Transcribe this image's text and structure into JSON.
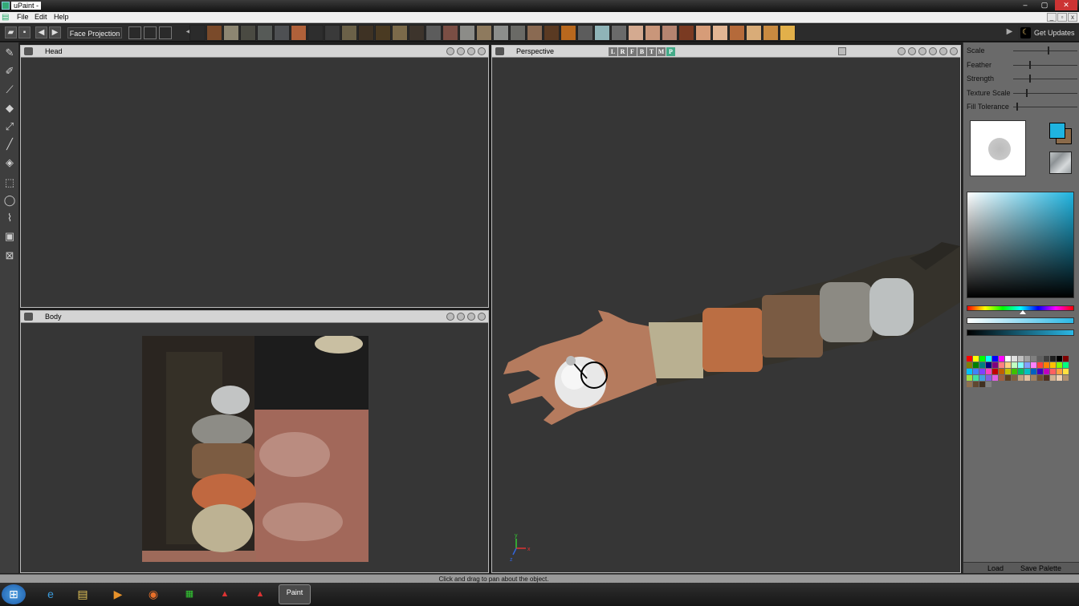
{
  "window": {
    "title": "uPaint -",
    "minimize": "–",
    "maximize": "▢",
    "close": "✕"
  },
  "menu": {
    "items": [
      "File",
      "Edit",
      "Help"
    ]
  },
  "toolbar": {
    "face_projection": "Face Projection",
    "get_updates": "Get Updates",
    "swatches": [
      "#2b2b2b",
      "#7a4a2a",
      "#8d8672",
      "#4a4a42",
      "#565a57",
      "#4e5053",
      "#b0613a",
      "#2e2e2e",
      "#3a3a3a",
      "#6b6148",
      "#3e3224",
      "#4a3a22",
      "#7b6a4a",
      "#3d342c",
      "#5c5c5c",
      "#7a4e44",
      "#8c8c88",
      "#8e7a5e",
      "#8c8e8c",
      "#6a6a66",
      "#8a6a52",
      "#5a3a22",
      "#b8681e",
      "#5c5c5c",
      "#8fb4b8",
      "#6a6a6a",
      "#d4aa90",
      "#c9967a",
      "#b58470",
      "#7a3a22",
      "#d69c78",
      "#e2b694",
      "#b56a3a",
      "#d9ac78",
      "#c88a40",
      "#e2b04a"
    ]
  },
  "panels": {
    "head": {
      "title": "Head"
    },
    "body": {
      "title": "Body"
    },
    "perspective": {
      "title": "Perspective",
      "view_letters": [
        "L",
        "R",
        "F",
        "B",
        "T",
        "M",
        "P"
      ]
    }
  },
  "right_panel": {
    "sliders": [
      {
        "label": "Scale",
        "value": 0.55
      },
      {
        "label": "Feather",
        "value": 0.25
      },
      {
        "label": "Strength",
        "value": 0.25
      },
      {
        "label": "Texture Scale",
        "value": 0.2
      },
      {
        "label": "Fill Tolerance",
        "value": 0.05
      }
    ],
    "primary_color": "#1fb4e0",
    "secondary_color": "#8a6a4a",
    "load_label": "Load",
    "save_palette_label": "Save Palette",
    "palette": [
      "#ff0000",
      "#ffff00",
      "#00ff00",
      "#00ffff",
      "#0000ff",
      "#ff00ff",
      "#ffffff",
      "#e0e0e0",
      "#c0c0c0",
      "#a0a0a0",
      "#808080",
      "#606060",
      "#404040",
      "#202020",
      "#000000",
      "#800000",
      "#808000",
      "#008000",
      "#008080",
      "#000080",
      "#800080",
      "#ff8080",
      "#ffd080",
      "#c0ffc0",
      "#80ffff",
      "#80a0ff",
      "#ff80ff",
      "#ff4040",
      "#ff8000",
      "#ffc000",
      "#80ff00",
      "#00ff80",
      "#00c0ff",
      "#4080ff",
      "#8040ff",
      "#ff40c0",
      "#c00000",
      "#c06000",
      "#c0c000",
      "#40c000",
      "#00c060",
      "#00c0c0",
      "#0060c0",
      "#4000c0",
      "#c000c0",
      "#ff6060",
      "#ffa040",
      "#ffe040",
      "#a0e040",
      "#40e0a0",
      "#40a0e0",
      "#8060e0",
      "#e060e0",
      "#a06040",
      "#604020",
      "#806040",
      "#c0a080",
      "#e0c0a0",
      "#a08060",
      "#705030",
      "#503020",
      "#d0b090",
      "#f0d0b0",
      "#b09070",
      "#907050",
      "#604830",
      "#403020",
      "#808080"
    ]
  },
  "status": {
    "text": "Click and drag to pan about the object."
  },
  "taskbar": {
    "items": [
      "start",
      "ie",
      "explorer",
      "media",
      "firefox",
      "app1",
      "app2",
      "app3",
      "upaint"
    ],
    "upaint_label": "Paint"
  }
}
